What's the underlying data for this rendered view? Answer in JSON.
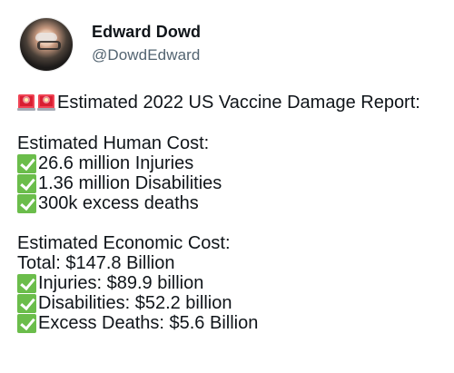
{
  "author": {
    "display_name": "Edward Dowd",
    "handle": "@DowdEdward"
  },
  "post": {
    "title": "Estimated 2022 US Vaccine Damage Report:",
    "human_cost": {
      "heading": "Estimated Human Cost:",
      "items": [
        "26.6 million Injuries",
        "1.36 million Disabilities",
        "300k excess deaths"
      ]
    },
    "economic_cost": {
      "heading": "Estimated Economic Cost:",
      "total": "Total: $147.8 Billion",
      "items": [
        "Injuries: $89.9 billion",
        "Disabilities: $52.2 billion",
        "Excess Deaths: $5.6 Billion"
      ]
    }
  },
  "icons": {
    "title_prefix": [
      "police-car-light-icon",
      "police-car-light-icon"
    ],
    "list_item": "check-mark-button-icon"
  },
  "colors": {
    "name_text": "#0f1419",
    "handle_text": "#536471",
    "check_green": "#6bbd4b",
    "siren_red": "#d91f32"
  }
}
